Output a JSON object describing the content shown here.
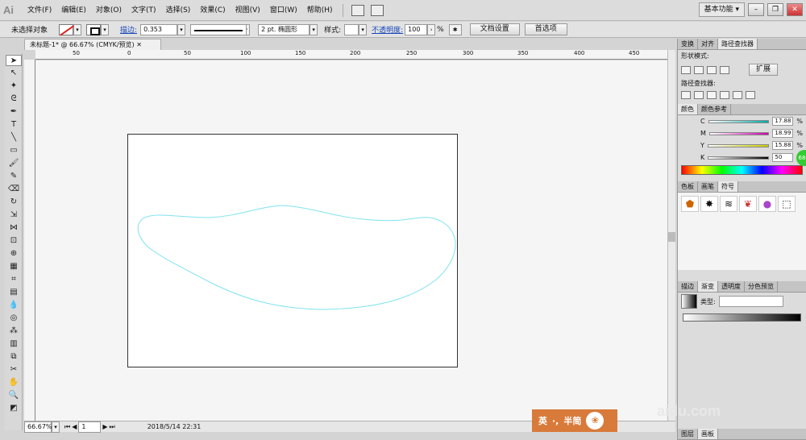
{
  "app": {
    "logo": "Ai",
    "workspace": "基本功能 ▾"
  },
  "menu": [
    "文件(F)",
    "编辑(E)",
    "对象(O)",
    "文字(T)",
    "选择(S)",
    "效果(C)",
    "视图(V)",
    "窗口(W)",
    "帮助(H)"
  ],
  "control": {
    "selection": "未选择对象",
    "stroke_label": "描边:",
    "stroke_value": "0.353",
    "profile": "等比",
    "brush": "2 pt. 椭圆形",
    "style_label": "样式:",
    "opacity_label": "不透明度:",
    "opacity_value": "100",
    "opacity_unit": "%",
    "doc_setup": "文档设置",
    "prefs": "首选项"
  },
  "document": {
    "tab": "未标题-1* @ 66.67% (CMYK/预览)"
  },
  "ruler_top": [
    "50",
    "0",
    "50",
    "100",
    "150",
    "200",
    "250",
    "300",
    "350",
    "400",
    "450"
  ],
  "status": {
    "zoom": "66.67%",
    "page": "1",
    "datetime": "2018/5/14  22:31"
  },
  "panels": {
    "transform_tabs": [
      "变换",
      "对齐",
      "路径查找器"
    ],
    "shape_modes": "形状模式:",
    "expand": "扩展",
    "pathfinders": "路径查找器:",
    "color_tabs": [
      "颜色",
      "颜色参考"
    ],
    "color": [
      {
        "ch": "C",
        "value": "17.88",
        "unit": "%"
      },
      {
        "ch": "M",
        "value": "18.99",
        "unit": "%"
      },
      {
        "ch": "Y",
        "value": "15.88",
        "unit": "%"
      },
      {
        "ch": "K",
        "value": "50",
        "unit": "%"
      }
    ],
    "swatch_tabs": [
      "色板",
      "画笔",
      "符号"
    ],
    "gradient_tabs": [
      "描边",
      "渐变",
      "透明度",
      "分色预览"
    ],
    "gradient_type": "类型:",
    "bottom_tabs": [
      "图层",
      "画板"
    ]
  },
  "ime": {
    "mode": "英",
    "dot": "·,",
    "simp": "半简"
  },
  "watermark": "aidu.com",
  "badge": "68",
  "colors": {
    "path_stroke": "#7fe3ef",
    "artboard": "#ffffff",
    "canvas": "#f5f5f5"
  }
}
